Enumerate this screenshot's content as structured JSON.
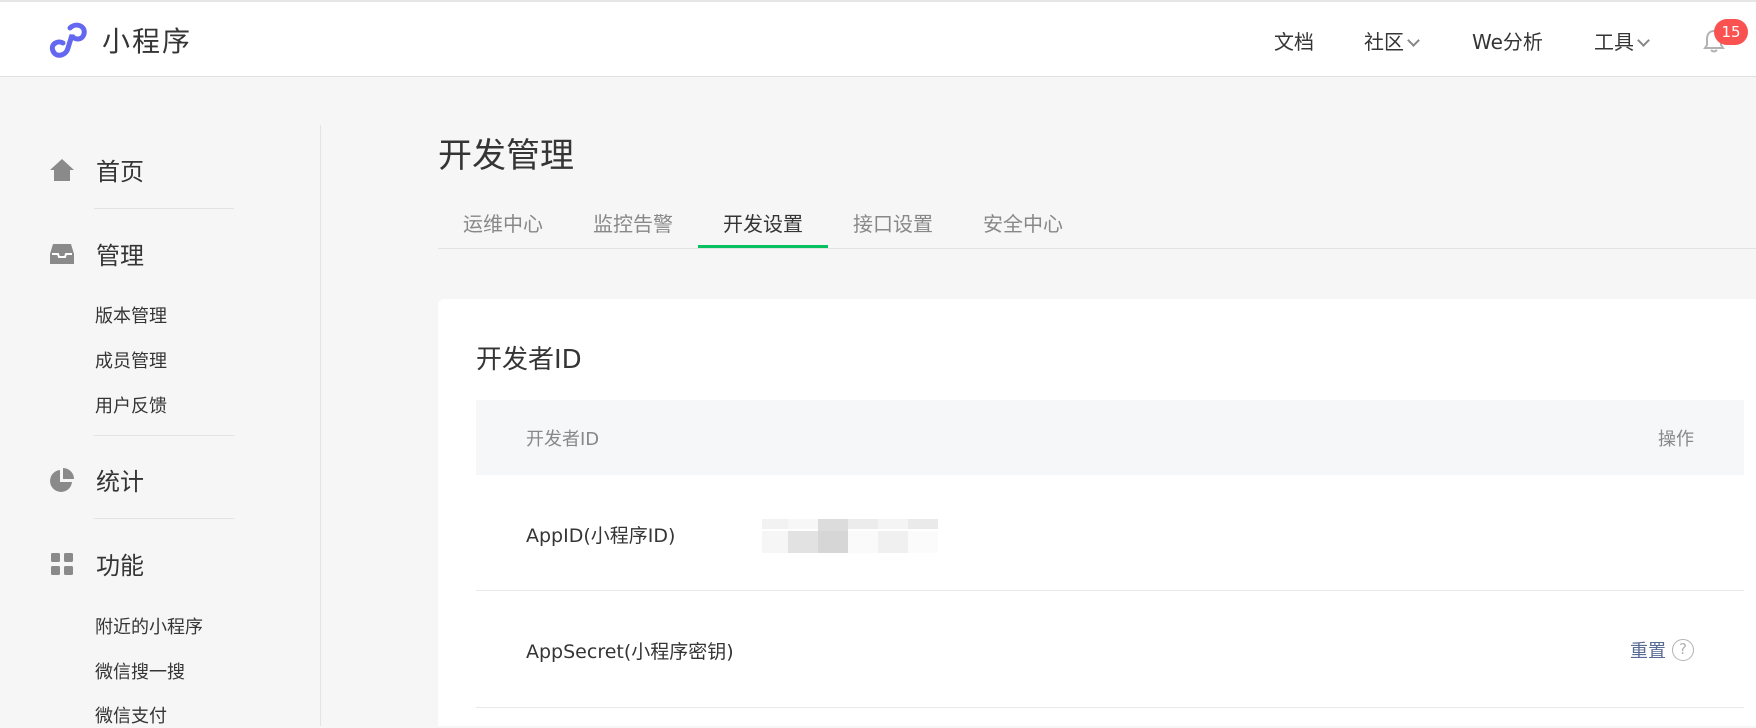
{
  "header": {
    "logo_text": "小程序",
    "nav": {
      "docs": "文档",
      "community": "社区",
      "analytics": "We分析",
      "tools": "工具"
    },
    "notification_count": "15"
  },
  "sidebar": {
    "home": "首页",
    "manage": "管理",
    "manage_items": [
      "版本管理",
      "成员管理",
      "用户反馈"
    ],
    "stats": "统计",
    "features": "功能",
    "feature_items": [
      "附近的小程序",
      "微信搜一搜",
      "微信支付"
    ]
  },
  "main": {
    "title": "开发管理",
    "tabs": [
      "运维中心",
      "监控告警",
      "开发设置",
      "接口设置",
      "安全中心"
    ],
    "active_tab_index": 2,
    "accent_color": "#07c160",
    "section": {
      "title": "开发者ID",
      "columns": [
        "开发者ID",
        "操作"
      ],
      "rows": [
        {
          "label": "AppID(小程序ID)",
          "value_hidden": true
        },
        {
          "label": "AppSecret(小程序密钥)",
          "action": "重置",
          "help": "?"
        }
      ]
    }
  }
}
